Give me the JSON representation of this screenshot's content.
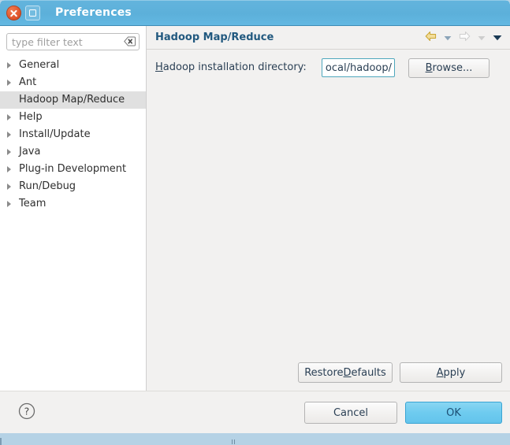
{
  "window": {
    "title": "Preferences",
    "close_icon": "close-icon",
    "maximize_icon": "maximize-icon"
  },
  "sidebar": {
    "filter": {
      "placeholder": "type filter text",
      "value": "",
      "clear_icon": "clear-icon"
    },
    "items": [
      {
        "label": "General",
        "expandable": true,
        "selected": false
      },
      {
        "label": "Ant",
        "expandable": true,
        "selected": false
      },
      {
        "label": "Hadoop Map/Reduce",
        "expandable": false,
        "selected": true
      },
      {
        "label": "Help",
        "expandable": true,
        "selected": false
      },
      {
        "label": "Install/Update",
        "expandable": true,
        "selected": false
      },
      {
        "label": "Java",
        "expandable": true,
        "selected": false
      },
      {
        "label": "Plug-in Development",
        "expandable": true,
        "selected": false
      },
      {
        "label": "Run/Debug",
        "expandable": true,
        "selected": false
      },
      {
        "label": "Team",
        "expandable": true,
        "selected": false
      }
    ]
  },
  "content": {
    "page_title": "Hadoop Map/Reduce",
    "nav": {
      "back_icon": "back-arrow-icon",
      "back_dropdown_icon": "chevron-down-icon",
      "forward_icon": "forward-arrow-icon",
      "forward_dropdown_icon": "chevron-down-icon",
      "menu_icon": "chevron-down-icon"
    },
    "field": {
      "label_prefix": "",
      "label_mnemonic": "H",
      "label_suffix": "adoop installation directory:",
      "value": "/local/hadoop",
      "placeholder": ""
    },
    "browse_button": {
      "mnemonic": "B",
      "suffix": "rowse..."
    },
    "restore_defaults_button": {
      "prefix": "Restore ",
      "mnemonic": "D",
      "suffix": "efaults"
    },
    "apply_button": {
      "mnemonic": "A",
      "suffix": "pply"
    }
  },
  "action_bar": {
    "help_icon": "help-icon",
    "cancel_label": "Cancel",
    "ok_label": "OK"
  },
  "colors": {
    "titlebar": "#5cb0da",
    "accent": "#22597f",
    "ok_button": "#6ecbef",
    "selection": "#e0e0e0",
    "focus_border": "#4fa7bd",
    "back_arrow": "#e8c55a"
  }
}
